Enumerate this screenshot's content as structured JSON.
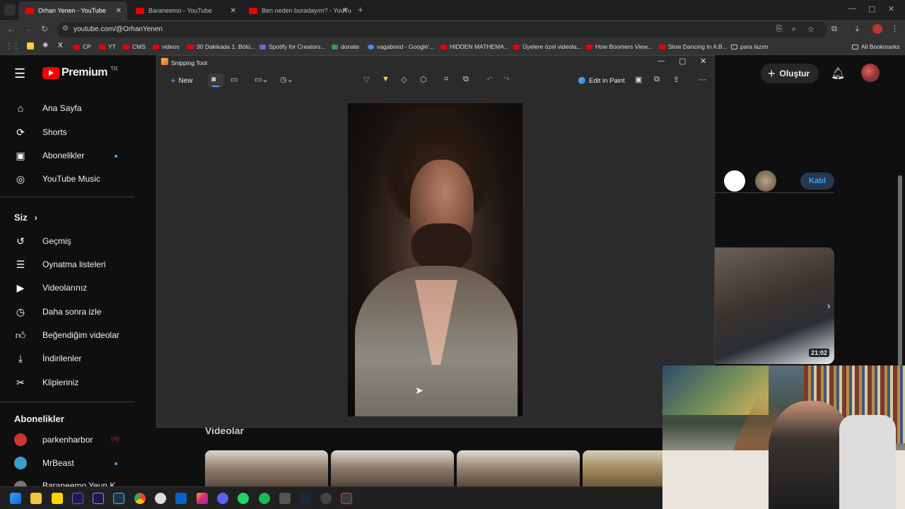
{
  "browser": {
    "tabs": [
      {
        "title": "Orhan Yenen - YouTube",
        "active": true
      },
      {
        "title": "Baraneemo - YouTube",
        "active": false
      },
      {
        "title": "Ben neden buradayım? - YouTu",
        "active": false
      }
    ],
    "url": "youtube.com/@OrhanYenen",
    "bookmarks": [
      "CP",
      "YT",
      "CMS",
      "videos",
      "30 Dakikada 1. Bölü...",
      "Spotify for Creators...",
      "donate",
      "vagabond - Google'...",
      "HIDDEN MATHEMA...",
      "Üyelere özel videola...",
      "How Boomers View...",
      "Slow Dancing In A B...",
      "para lazım"
    ],
    "all_bookmarks": "All Bookmarks"
  },
  "youtube": {
    "logo": "Premium",
    "region": "TR",
    "create_label": "Oluştur",
    "join_label": "Katıl",
    "main_nav": [
      {
        "label": "Ana Sayfa",
        "icon": "home-icon"
      },
      {
        "label": "Shorts",
        "icon": "shorts-icon"
      },
      {
        "label": "Abonelikler",
        "icon": "subscriptions-icon"
      },
      {
        "label": "YouTube Music",
        "icon": "music-icon"
      }
    ],
    "you_section": "Siz",
    "you_nav": [
      {
        "label": "Geçmiş",
        "icon": "history-icon"
      },
      {
        "label": "Oynatma listeleri",
        "icon": "playlist-icon"
      },
      {
        "label": "Videolarınız",
        "icon": "your-videos-icon"
      },
      {
        "label": "Daha sonra izle",
        "icon": "watch-later-icon"
      },
      {
        "label": "Beğendiğim videolar",
        "icon": "like-icon"
      },
      {
        "label": "İndirilenler",
        "icon": "download-icon"
      },
      {
        "label": "Klipleriniz",
        "icon": "clips-icon"
      }
    ],
    "subs_section": "Abonelikler",
    "subscriptions": [
      "parkenharbor",
      "MrBeast",
      "Baraneemo Yeun K"
    ],
    "videos_heading": "Videolar",
    "thumb_duration": "21:02"
  },
  "snipping_tool": {
    "title": "Snipping Tool",
    "new_label": "New",
    "edit_in_paint": "Edit in Paint"
  },
  "colors": {
    "youtube_red": "#ff0000",
    "accent_blue": "#3ea6ff",
    "join_blue": "#3ea6ff"
  }
}
